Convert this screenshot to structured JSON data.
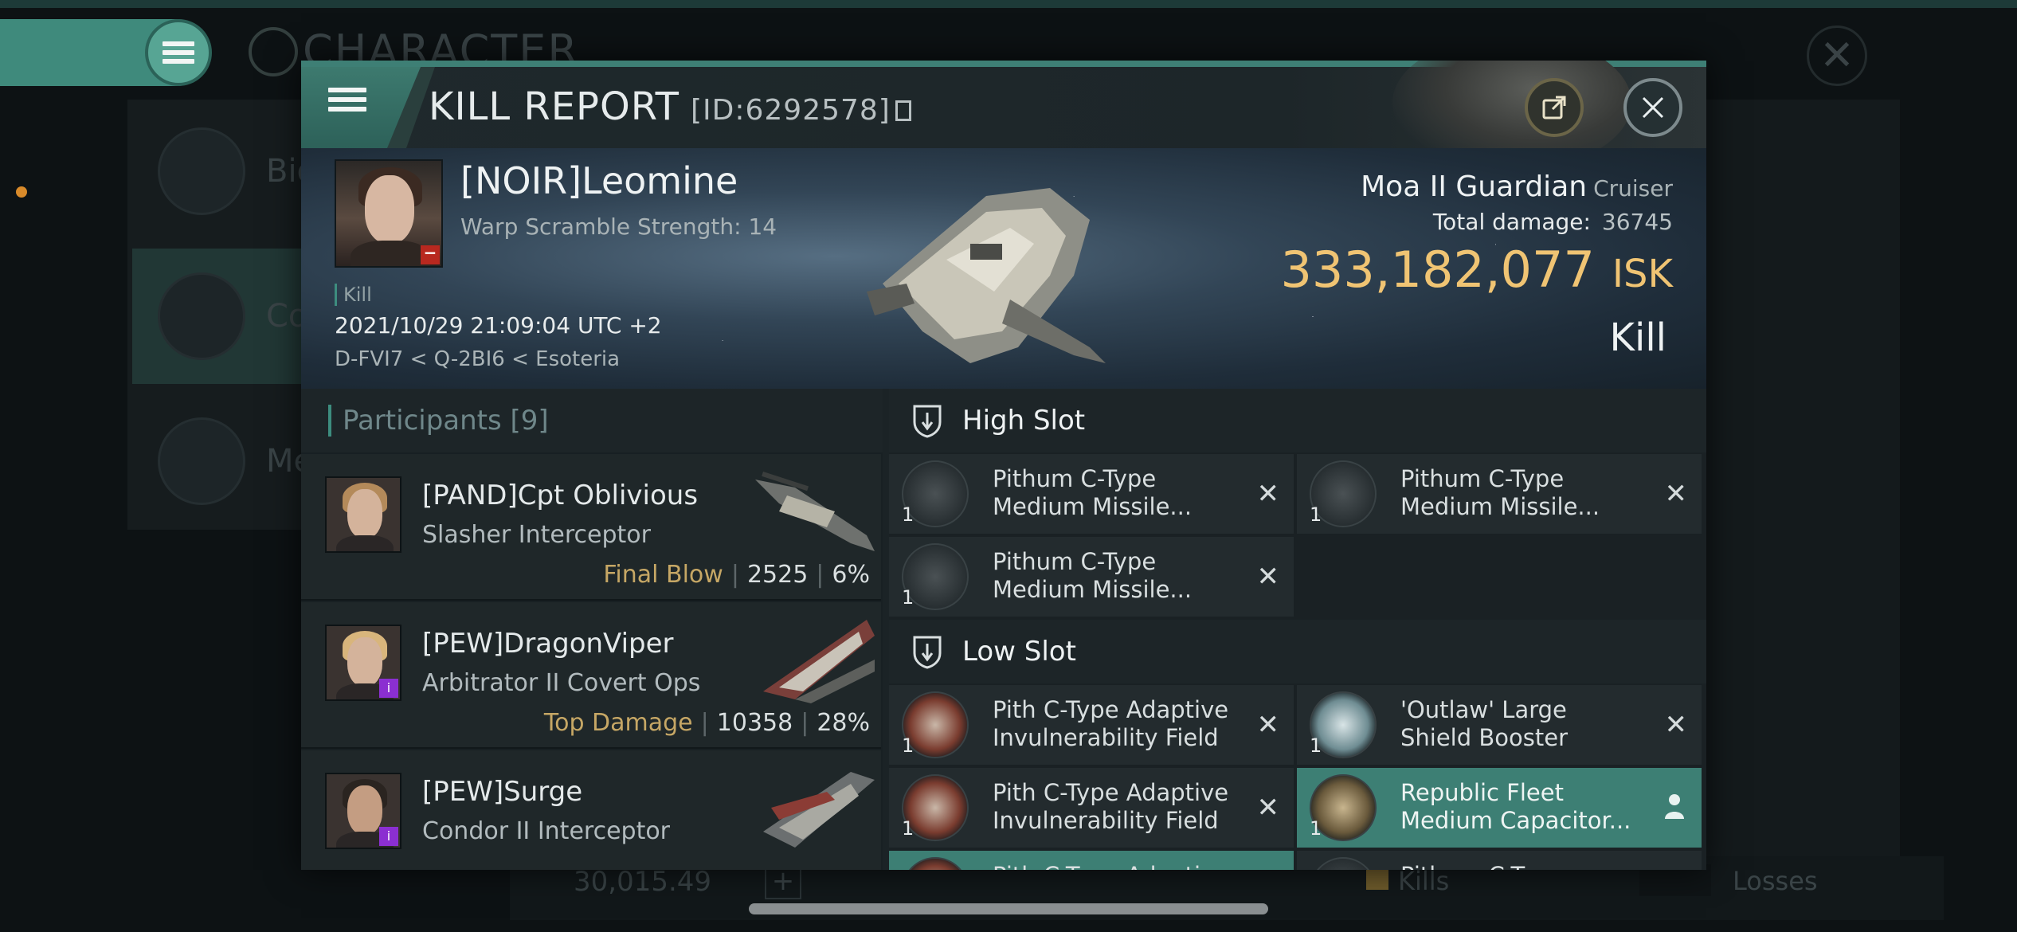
{
  "background": {
    "title": "CHARACTER",
    "side_items": [
      "Bio",
      "Co",
      "Me"
    ],
    "bottom": {
      "amount": "30,015.49",
      "kills_label": "Kills",
      "losses_label": "Losses"
    }
  },
  "header": {
    "title": "KILL REPORT",
    "report_id": "[ID:6292578]"
  },
  "victim": {
    "name": "[NOIR]Leomine",
    "subtitle": "Warp Scramble Strength: 14",
    "tag": "Kill",
    "datetime": "2021/10/29 21:09:04 UTC +2",
    "location": "D-FVI7 < Q-2BI6 < Esoteria",
    "ship_name": "Moa II Guardian",
    "ship_class": "Cruiser",
    "total_damage_label": "Total damage:",
    "total_damage": "36745",
    "isk_value": "333,182,077",
    "isk_unit": "ISK",
    "result": "Kill"
  },
  "participants": {
    "label": "Participants",
    "count": "[9]",
    "rows": [
      {
        "name": "[PAND]Cpt Oblivious",
        "ship": "Slasher Interceptor",
        "role": "Final Blow",
        "damage": "2525",
        "percent": "6%"
      },
      {
        "name": "[PEW]DragonViper",
        "ship": "Arbitrator II Covert Ops",
        "role": "Top Damage",
        "damage": "10358",
        "percent": "28%"
      },
      {
        "name": "[PEW]Surge",
        "ship": "Condor II Interceptor",
        "role": "",
        "damage": "",
        "percent": ""
      }
    ]
  },
  "slots": {
    "high": {
      "label": "High Slot",
      "modules": [
        {
          "name": "Pithum C-Type Medium Missile...",
          "qty": "1"
        },
        {
          "name": "Pithum C-Type Medium Missile...",
          "qty": "1"
        },
        {
          "name": "Pithum C-Type Medium Missile...",
          "qty": "1"
        }
      ]
    },
    "low": {
      "label": "Low Slot",
      "modules": [
        {
          "name": "Pith C-Type Adaptive Invulnerability Field",
          "qty": "1"
        },
        {
          "name": "'Outlaw' Large Shield Booster",
          "qty": "1"
        },
        {
          "name": "Pith C-Type Adaptive Invulnerability Field",
          "qty": "1"
        },
        {
          "name": "Republic Fleet Medium Capacitor...",
          "qty": "1"
        },
        {
          "name": "Pith C-Type Adaptive",
          "qty": ""
        },
        {
          "name": "Pithum C-Type",
          "qty": ""
        }
      ]
    }
  },
  "colors": {
    "accent_teal": "#3d7f74",
    "isk_gold": "#f0c473",
    "role_gold": "#c6a765",
    "badge_red": "#b8281f",
    "corp_purple": "#8b2fd1"
  }
}
